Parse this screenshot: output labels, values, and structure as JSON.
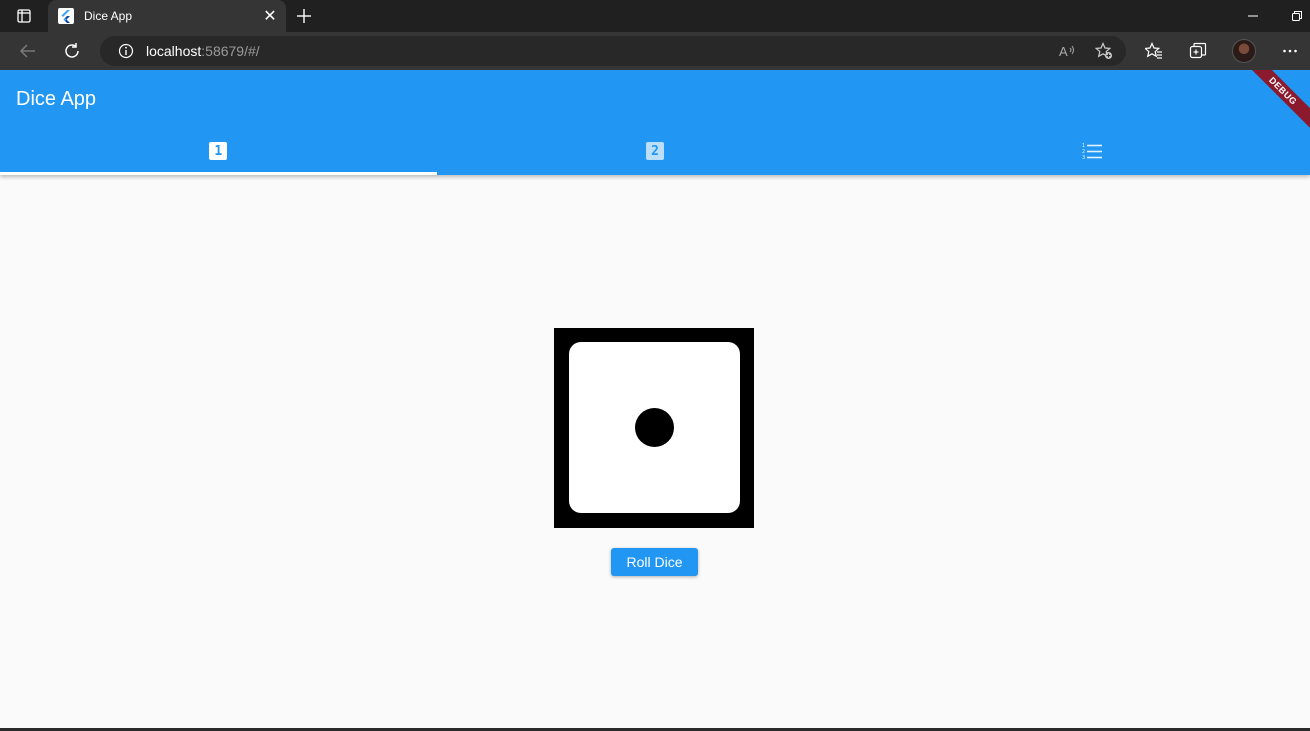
{
  "browser": {
    "tab_title": "Dice App",
    "tab_close": "✕",
    "new_tab": "+",
    "url_host": "localhost",
    "url_rest": ":58679/#/"
  },
  "app": {
    "title": "Dice App",
    "debug_banner": "DEBUG",
    "tabs": [
      {
        "label": "1",
        "active": true
      },
      {
        "label": "2",
        "active": false
      },
      {
        "icon": "list-icon",
        "active": false
      }
    ],
    "dice_value": 1,
    "roll_button_label": "Roll Dice",
    "accent_color": "#2196f3"
  }
}
